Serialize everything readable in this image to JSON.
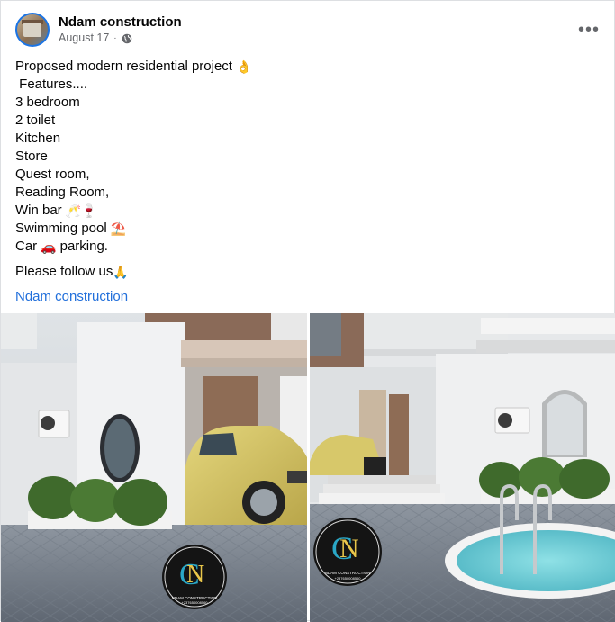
{
  "post": {
    "page_name": "Ndam construction",
    "date": "August 17",
    "more_label": "•••",
    "lines": [
      "Proposed modern residential project",
      " Features....",
      "3 bedroom",
      "2 toilet",
      "Kitchen",
      "Store",
      "Quest room,",
      "Reading Room,",
      "Win bar",
      "Swimming pool",
      "Car",
      "parking."
    ],
    "follow": "Please follow us",
    "link": "Ndam construction",
    "emojis": {
      "ok": "👌",
      "wine": "🥂🍷",
      "umbrella": "⛱️",
      "car": "🚗",
      "pray": "🙏"
    }
  },
  "photos": [
    {
      "logo_text": "NDAM CONSTRUCTION",
      "logo_phone": "+237650008560"
    },
    {
      "logo_text": "NDAM CONSTRUCTION",
      "logo_phone": "+237650008560"
    }
  ],
  "colors": {
    "link": "#216fdb",
    "avatar_ring": "#1b74e4",
    "text_secondary": "#65676b",
    "car_yellow": "#d9c86a",
    "pool_water": "#6fcfd6"
  },
  "icons": [
    "globe-icon",
    "more-options-icon"
  ]
}
